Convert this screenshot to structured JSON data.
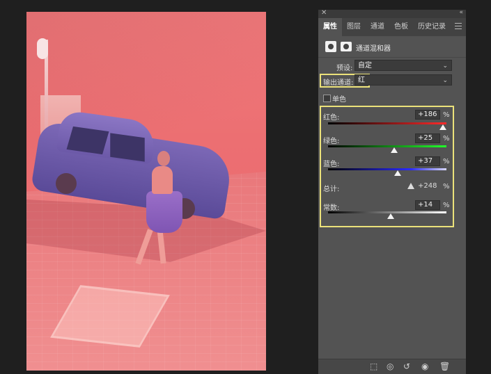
{
  "panel": {
    "tabs": [
      {
        "label": "属性",
        "active": true
      },
      {
        "label": "图层"
      },
      {
        "label": "通道"
      },
      {
        "label": "色板"
      },
      {
        "label": "历史记录"
      }
    ],
    "adjustment_title": "通道混和器",
    "preset_label": "预设:",
    "preset_value": "自定",
    "output_channel_label": "输出通道:",
    "output_channel_value": "红",
    "monochrome_label": "单色",
    "monochrome_checked": false,
    "sliders": {
      "red": {
        "label": "红色:",
        "value": "+186",
        "unit": "%",
        "level": 0.97
      },
      "green": {
        "label": "绿色:",
        "value": "+25",
        "unit": "%",
        "level": 0.56
      },
      "blue": {
        "label": "蓝色:",
        "value": "+37",
        "unit": "%",
        "level": 0.59
      },
      "constant": {
        "label": "常数:",
        "value": "+14",
        "unit": "%",
        "level": 0.53
      }
    },
    "total_label": "总计:",
    "total_value": "+248",
    "total_unit": "%",
    "icons": {
      "close": "close-icon",
      "collapse": "collapse-icon",
      "menu": "menu-icon",
      "adjustment": "channel-mixer-icon",
      "mask": "mask-icon",
      "warning": "warning-icon",
      "clip_to_layer": "clip-to-layer-icon",
      "view_previous": "view-previous-icon",
      "reset": "reset-icon",
      "visibility": "eye-icon",
      "delete": "trash-icon"
    },
    "colors": {
      "highlight": "#ece27a",
      "panel_bg": "#535353"
    }
  },
  "canvas": {
    "description_colors": {
      "tint": "#ec6f72"
    }
  }
}
